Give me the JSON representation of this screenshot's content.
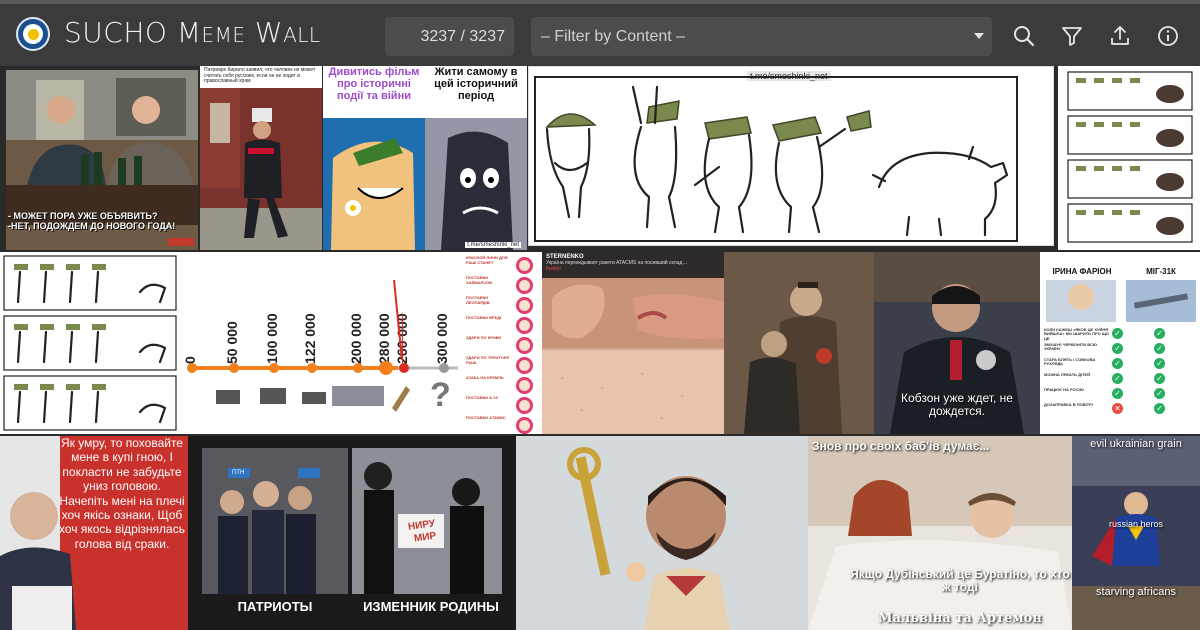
{
  "header": {
    "title_prefix": "SUCHO ",
    "title_word1_initial": "M",
    "title_word1_rest": "eme",
    "title_space": " ",
    "title_word2_initial": "W",
    "title_word2_rest": "all",
    "counter": "3237 / 3237",
    "filter_placeholder": "– Filter by Content –",
    "icons": [
      "search-icon",
      "filter-icon",
      "upload-icon",
      "info-icon"
    ]
  },
  "colors": {
    "header_bg": "#3b3b3b",
    "control_bg": "#4c4c4c",
    "accent_orange": "#f2811d",
    "ukraine_blue": "#1a4f8f",
    "ukraine_yellow": "#f2c200"
  },
  "memes": {
    "m1": {
      "caption": "- МОЖЕТ ПОРА УЖЕ ОБЪЯВИТЬ?\n-НЕТ, ПОДОЖДЕМ ДО НОВОГО ГОДА!"
    },
    "m2": {
      "caption": "Патриарх Кирилл заявил, что человек не может считать себя русским, если он не ходит в православный храм"
    },
    "m3": {
      "top_left": "Дивитись фільм про історичні події та війни",
      "top_right": "Жити самому в цей історичний період",
      "watermark": "t.me/smeshinki_net"
    },
    "m4": {
      "watermark": "t.me/smeshinki_net"
    },
    "m7": {
      "values": [
        "0",
        "50 000",
        "100 000",
        "122 000",
        "200 000",
        "280 000",
        "260 000",
        "300 000"
      ],
      "question": "?"
    },
    "m8": {
      "rows": [
        "КРАСНОЙ ЛИНИ ДЛЯ РАШІ СТАНЕТ",
        "ПОСТАВКИ ХАЙМАРСОВ",
        "ПОСТАВКИ ЛЕОПАРДІВ",
        "ПОСТАВКИ ВРЕДІ",
        "УДАРИ ПО КРИМУ",
        "УДАРИ ПО ТЕРИТОРІЇ РАШІ",
        "АТАКА НА КРЕМЛЬ",
        "ПОСТАВКИ А-10",
        "ПОСТАВКИ АТАКМС"
      ]
    },
    "m9": {
      "source": "STERNENKO",
      "caption": "Україна перекидывает ракети ATACMS на посивший склад…",
      "link": "Купібо"
    },
    "m11": {
      "caption": "Кобзон уже ждет, не дождется."
    },
    "m12": {
      "left": "ІРИНА ФАРІОН",
      "right": "МІГ-31К",
      "rows": [
        "КОЛИ КАЖЕШ «ЯКОБ ЦЕ ХУЙНЯ ВИЙШЛА» МО ШАРИТЬ ПРО ЩО ЦЕ",
        "ЗМУШУЄ ЧЕРВОНІТИ ВСЮ УКРАЇНУ",
        "СТАРА БЛЯТЬ І СОВКОВА РУХЛЯДЬ",
        "МОЖНА ЛЯКАТЬ ДІТЕЙ",
        "ПРАЦЮЄ НА РОСІЮ",
        "ДОЗАПРАВКА В ПОВІТРІ"
      ],
      "left_marks": [
        "yes",
        "yes",
        "yes",
        "yes",
        "yes",
        "no"
      ],
      "right_marks": [
        "yes",
        "yes",
        "yes",
        "yes",
        "yes",
        "yes"
      ]
    },
    "m13": {
      "caption": "Як умру, то поховайте мене в купі гною, І покласти не забудьте униз головою. Начепіть мені на плечі хоч якісь ознаки, Щоб хоч якось відрізнялась голова від сраки."
    },
    "m14": {
      "left": "ПАТРИОТЫ",
      "right": "ИЗМЕННИК РОДИНЫ",
      "sign1": "НИРУ",
      "sign2": "МИР",
      "helmet": "ПТН"
    },
    "m16": {
      "top": "Знов про своїх баб'ів думає...",
      "bottom": "Якщо Дубінський це Буратіно, то хто ж тоді",
      "bottom2": "Мальвіна та Артемон"
    },
    "m17": {
      "top": "evil ukrainian grain",
      "middle": "russian heros",
      "bottom": "starving africans"
    }
  }
}
